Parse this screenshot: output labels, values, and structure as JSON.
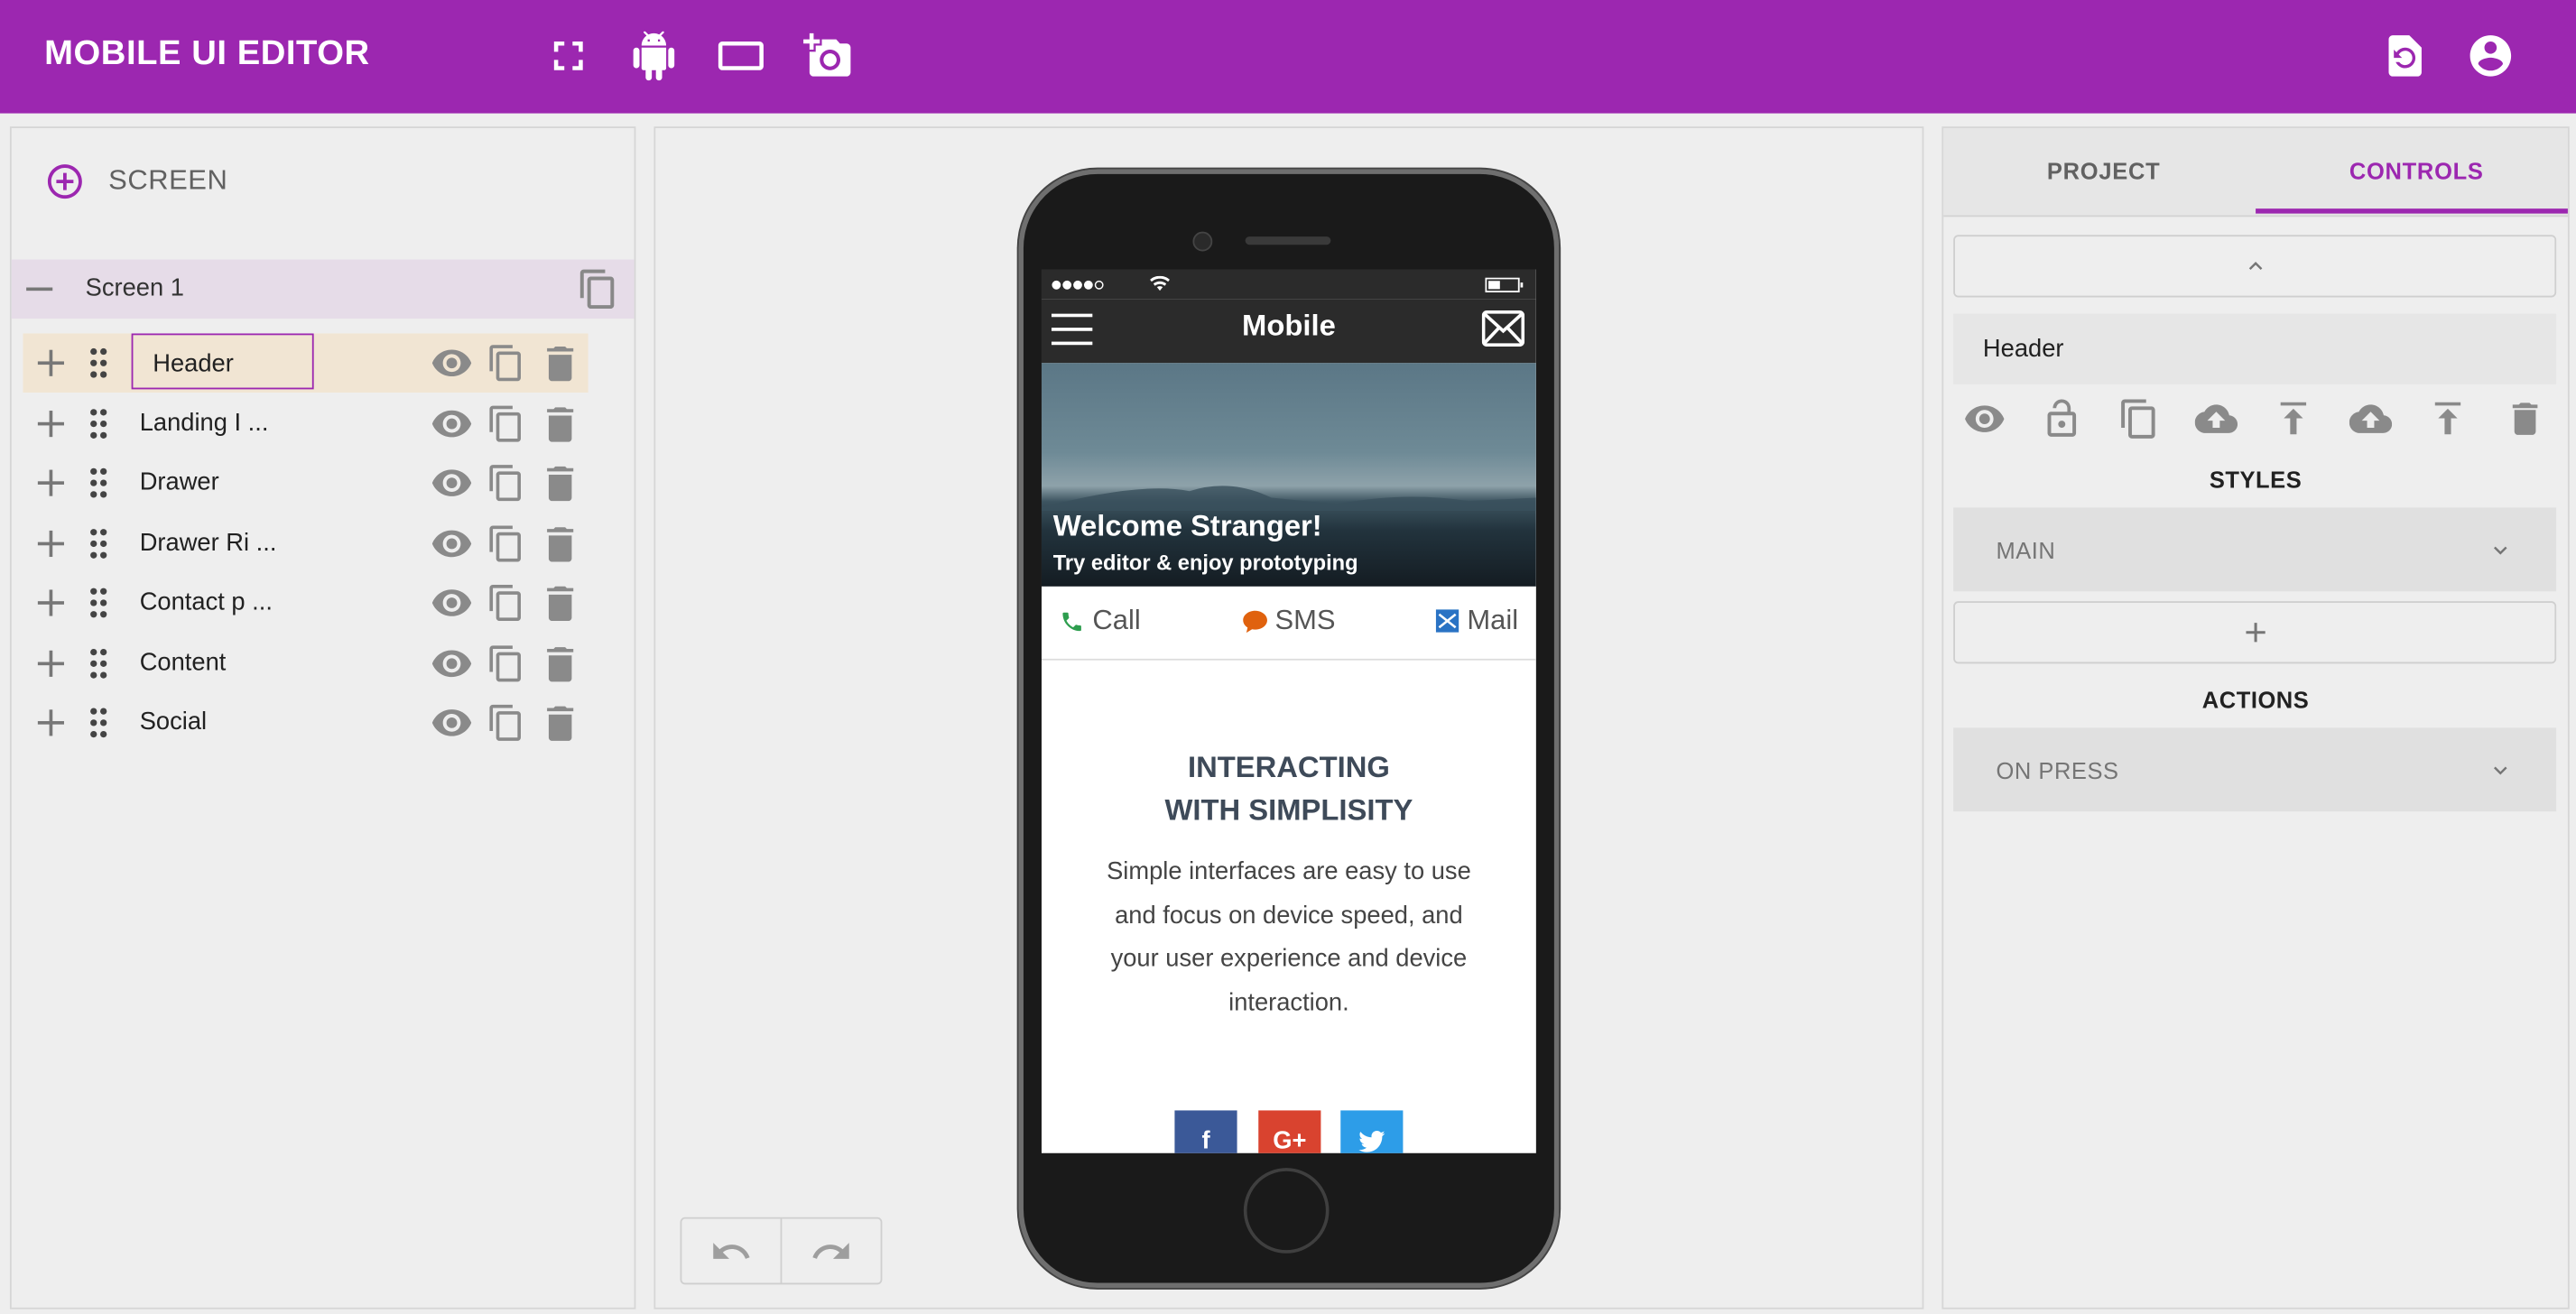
{
  "app": {
    "title": "MOBILE UI EDITOR",
    "accent_color": "#9c27b0",
    "toolbar_icons": [
      "fullscreen-icon",
      "android-icon",
      "tablet-landscape-icon",
      "add-photo-icon"
    ],
    "right_icons": [
      "restore-file-icon",
      "account-circle-icon"
    ]
  },
  "left_panel": {
    "add_screen_label": "SCREEN",
    "screen_name": "Screen 1",
    "components": [
      {
        "name": "Header"
      },
      {
        "name": "Landing I  ..."
      },
      {
        "name": "Drawer"
      },
      {
        "name": "Drawer Ri ..."
      },
      {
        "name": "Contact p ..."
      },
      {
        "name": "Content"
      },
      {
        "name": "Social"
      }
    ]
  },
  "preview": {
    "nav_title": "Mobile",
    "hero_title": "Welcome Stranger!",
    "hero_subtitle": "Try editor & enjoy prototyping",
    "contact": {
      "call": "Call",
      "sms": "SMS",
      "mail": "Mail"
    },
    "content_heading_line1": "INTERACTING",
    "content_heading_line2": "WITH SIMPLISITY",
    "content_body": "Simple interfaces are easy to use and focus on device speed, and your user experience and device interaction.",
    "social": {
      "facebook": "f",
      "google": "G+"
    }
  },
  "right_panel": {
    "tabs": [
      "PROJECT",
      "CONTROLS"
    ],
    "active_tab": "CONTROLS",
    "selected_component": "Header",
    "styles_title": "STYLES",
    "styles_dropdown": "MAIN",
    "actions_title": "ACTIONS",
    "actions_dropdown": "ON PRESS"
  }
}
